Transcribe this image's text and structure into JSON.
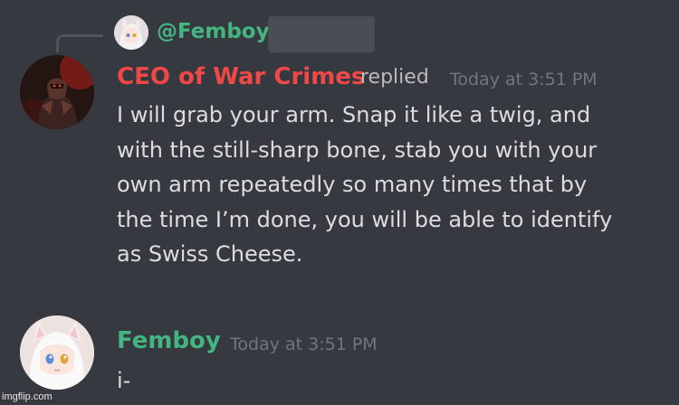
{
  "reply": {
    "mention": "@Femboy",
    "avatar_icon": "anime-avatar-icon"
  },
  "messages": [
    {
      "author": "CEO of War Crimes",
      "author_color": "#f04747",
      "action": "replied",
      "timestamp": "Today at 3:51 PM",
      "avatar_icon": "armored-character-avatar-icon",
      "lines": [
        "I will grab your arm. Snap it like a twig, and",
        "with the still-sharp bone, stab you with your",
        "own arm repeatedly so many times that by",
        "the time I’m done, you will be able to identify",
        "as Swiss Cheese."
      ]
    },
    {
      "author": "Femboy",
      "author_color": "#43b581",
      "timestamp": "Today at 3:51 PM",
      "avatar_icon": "anime-avatar-icon",
      "lines": [
        "i-"
      ]
    }
  ],
  "watermark": "imgflip.com",
  "colors": {
    "background": "#36393f",
    "text": "#dcddde",
    "timestamp": "#72767d"
  }
}
